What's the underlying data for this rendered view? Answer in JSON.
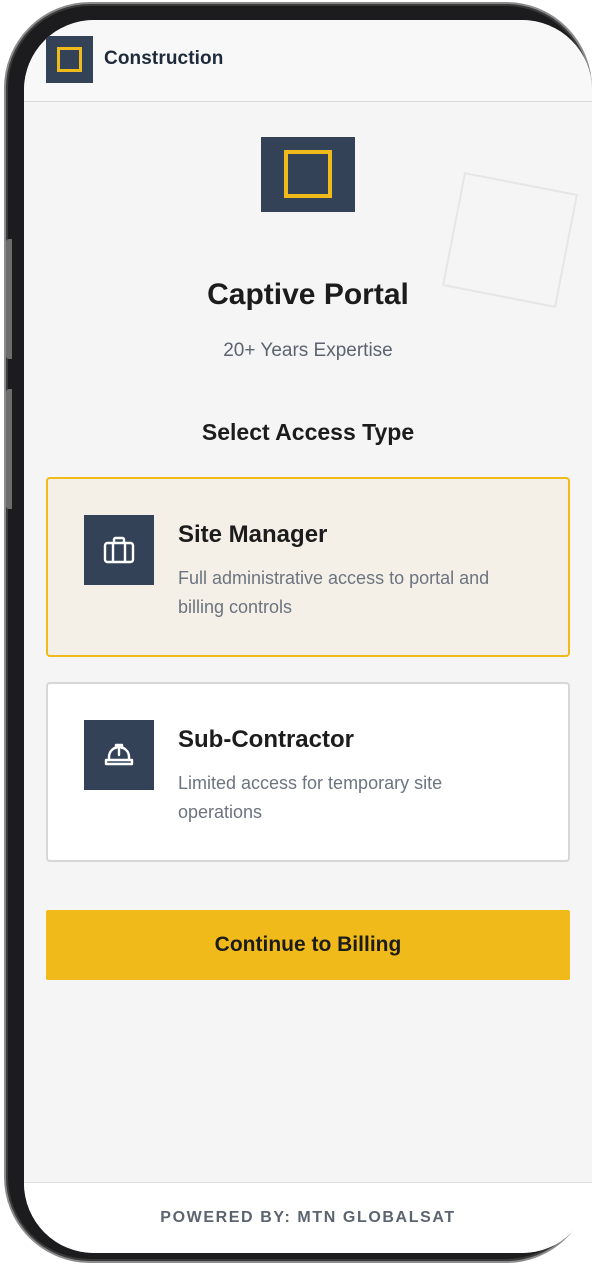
{
  "header": {
    "brand_name": "Construction",
    "logo_icon": "square-logo-icon"
  },
  "hero": {
    "logo_icon": "square-logo-icon",
    "title": "Captive Portal",
    "subtitle": "20+ Years Expertise"
  },
  "access": {
    "section_title": "Select Access Type",
    "options": [
      {
        "icon": "briefcase-icon",
        "title": "Site Manager",
        "description": "Full administrative access to portal and billing controls",
        "selected": true
      },
      {
        "icon": "hard-hat-icon",
        "title": "Sub-Contractor",
        "description": "Limited access for temporary site operations",
        "selected": false
      }
    ]
  },
  "actions": {
    "continue_label": "Continue to Billing"
  },
  "footer": {
    "powered_by": "POWERED BY: MTN GLOBALSAT"
  },
  "colors": {
    "accent": "#f0bb1a",
    "navy": "#334257",
    "selected_bg": "#f4f0e7",
    "background": "#f5f5f5"
  }
}
